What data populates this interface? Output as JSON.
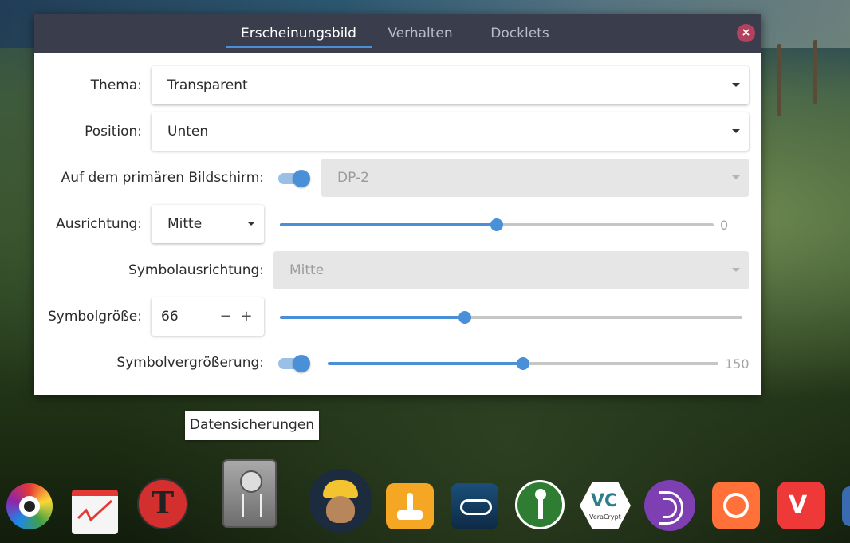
{
  "tabs": [
    {
      "label": "Erscheinungsbild",
      "active": true
    },
    {
      "label": "Verhalten",
      "active": false
    },
    {
      "label": "Docklets",
      "active": false
    }
  ],
  "close_label": "×",
  "form": {
    "thema_label": "Thema:",
    "thema_value": "Transparent",
    "position_label": "Position:",
    "position_value": "Unten",
    "primary_label": "Auf dem primären Bildschirm:",
    "primary_on": true,
    "monitor_value": "DP-2",
    "ausrichtung_label": "Ausrichtung:",
    "ausrichtung_value": "Mitte",
    "offset_value": "0",
    "offset_fraction": 0.5,
    "symbolausrichtung_label": "Symbolausrichtung:",
    "symbolausrichtung_value": "Mitte",
    "symbolgroesse_label": "Symbolgröße:",
    "symbolgroesse_value": "66",
    "symbolgroesse_minus": "−",
    "symbolgroesse_plus": "+",
    "symbolgroesse_fraction": 0.4,
    "zoom_label": "Symbolvergrößerung:",
    "zoom_on": true,
    "zoom_value": "150",
    "zoom_fraction": 0.5
  },
  "tooltip": "Datensicherungen",
  "dock": [
    {
      "name": "color-picker-icon",
      "color": "#e33"
    },
    {
      "name": "drawing-app-icon",
      "color": "#e53935"
    },
    {
      "name": "red-t-app-icon",
      "color": "#d32f2f"
    },
    {
      "name": "backup-safe-icon",
      "color": "#8a8a8a"
    },
    {
      "name": "mailspring-icon",
      "color": "#f4c430"
    },
    {
      "name": "game-launcher-icon",
      "color": "#f5a623"
    },
    {
      "name": "steam-icon",
      "color": "#1b4f7a"
    },
    {
      "name": "keepassxc-icon",
      "color": "#4caf50"
    },
    {
      "name": "veracrypt-icon",
      "color": "#2e7d8a"
    },
    {
      "name": "tor-browser-icon",
      "color": "#7e3fb2"
    },
    {
      "name": "firefox-icon",
      "color": "#ff7139"
    },
    {
      "name": "vivaldi-icon",
      "color": "#ef3939"
    },
    {
      "name": "partial-icon",
      "color": "#3a6ab0"
    }
  ],
  "dock_labels": {
    "veracrypt": "VeraCrypt"
  }
}
